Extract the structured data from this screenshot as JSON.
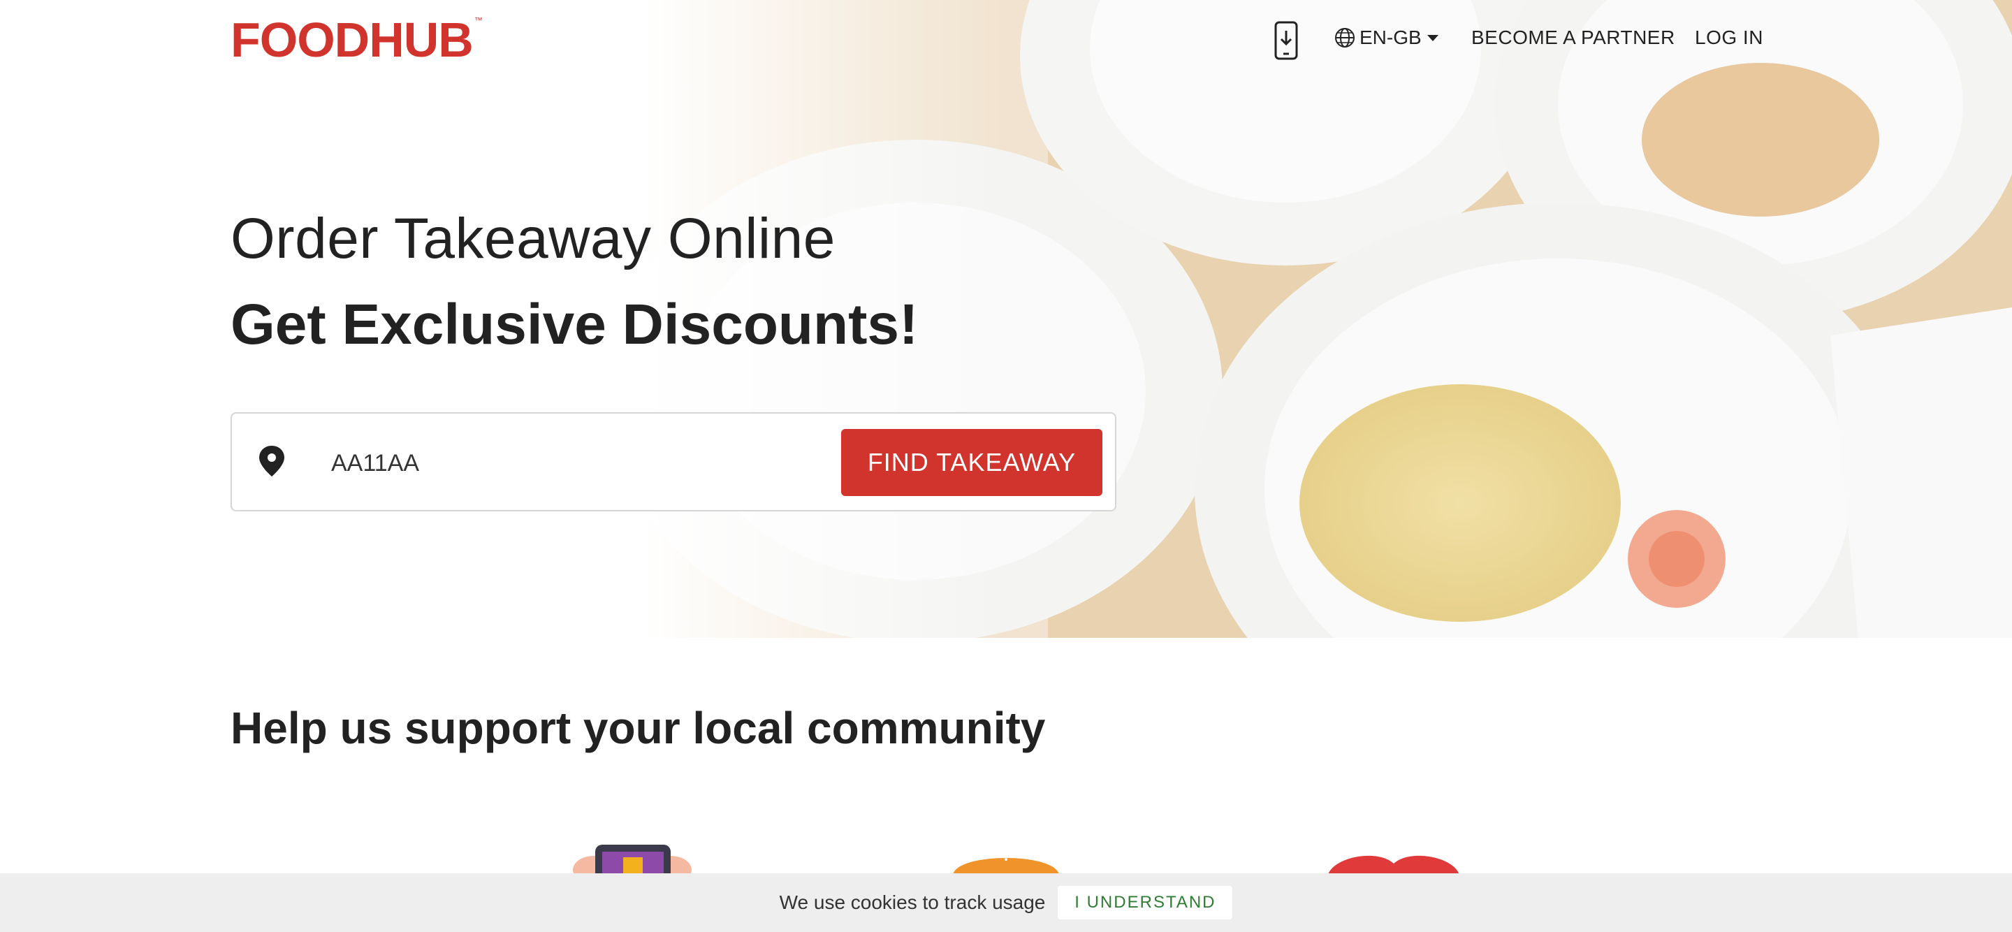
{
  "brand": {
    "logo_text": "FOODHUB",
    "logo_tm": "™",
    "accent": "#d1342d"
  },
  "nav": {
    "app_icon": "mobile-download-icon",
    "language": "EN-GB",
    "language_icon": "globe-icon",
    "partner": "BECOME A PARTNER",
    "login": "LOG IN"
  },
  "hero": {
    "line1": "Order Takeaway Online",
    "line2": "Get Exclusive Discounts!"
  },
  "search": {
    "location_icon": "location-pin-icon",
    "value": "AA11AA",
    "button": "FIND TAKEAWAY"
  },
  "section": {
    "title": "Help us support your local community"
  },
  "cookie": {
    "text": "We use cookies to track usage",
    "button": "I UNDERSTAND",
    "button_color": "#2e7d32"
  }
}
